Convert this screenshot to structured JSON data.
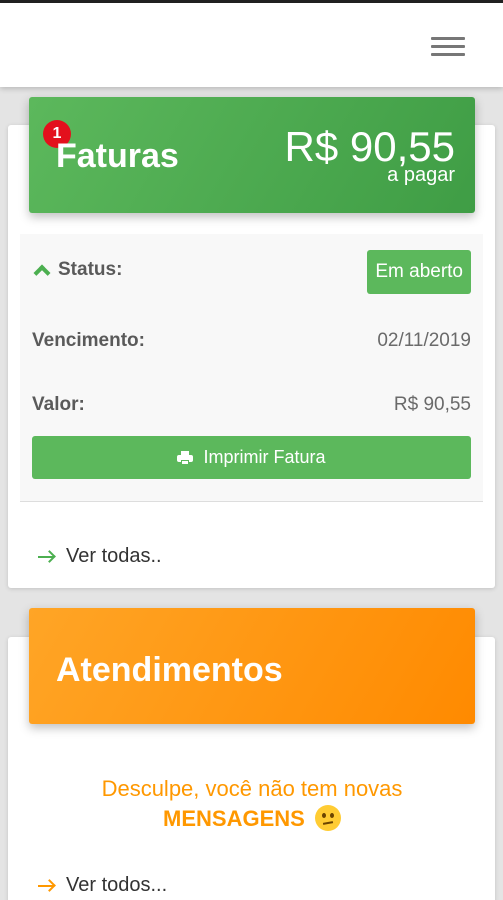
{
  "menu_icon": "hamburger-menu-icon",
  "faturas": {
    "badge_count": "1",
    "title": "Faturas",
    "amount": "R$ 90,55",
    "amount_caption": "a pagar",
    "status_label": "Status:",
    "status_value": "Em aberto",
    "vencimento_label": "Vencimento:",
    "vencimento_value": "02/11/2019",
    "valor_label": "Valor:",
    "valor_value": "R$ 90,55",
    "print_button": "Imprimir Fatura",
    "ver_todas": "Ver todas..",
    "colors": {
      "header": "#4caf50",
      "badge": "#e3101c"
    }
  },
  "atendimentos": {
    "title": "Atendimentos",
    "empty_line1": "Desculpe, você não tem novas",
    "empty_line2": "MENSAGENS",
    "ver_todos": "Ver todos...",
    "colors": {
      "header": "#ff9800"
    }
  }
}
